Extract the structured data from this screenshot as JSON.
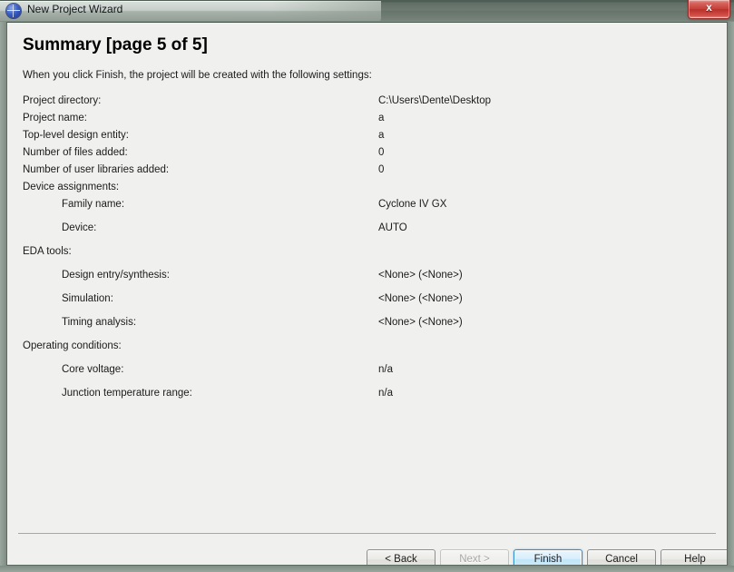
{
  "window": {
    "title": "New Project Wizard",
    "app_icon": "quartus-globe-icon",
    "close_label": "x"
  },
  "page": {
    "title": "Summary [page 5 of 5]",
    "intro": "When you click Finish, the project will be created with the following settings:"
  },
  "settings": [
    {
      "label": "Project directory:",
      "value": "C:\\Users\\Dente\\Desktop",
      "indent": false,
      "spacing": "tight"
    },
    {
      "label": "Project name:",
      "value": "a",
      "indent": false,
      "spacing": "tight"
    },
    {
      "label": "Top-level design entity:",
      "value": "a",
      "indent": false,
      "spacing": "tight"
    },
    {
      "label": "Number of files added:",
      "value": "0",
      "indent": false,
      "spacing": "tight"
    },
    {
      "label": "Number of user libraries added:",
      "value": "0",
      "indent": false,
      "spacing": "tight"
    },
    {
      "label": "Device assignments:",
      "value": "",
      "indent": false,
      "spacing": "tight"
    },
    {
      "label": "Family name:",
      "value": "Cyclone IV GX",
      "indent": true,
      "spacing": "loose"
    },
    {
      "label": "Device:",
      "value": "AUTO",
      "indent": true,
      "spacing": "loose"
    },
    {
      "label": "EDA tools:",
      "value": "",
      "indent": false,
      "spacing": "loose"
    },
    {
      "label": "Design entry/synthesis:",
      "value": "<None> (<None>)",
      "indent": true,
      "spacing": "loose"
    },
    {
      "label": "Simulation:",
      "value": "<None> (<None>)",
      "indent": true,
      "spacing": "loose"
    },
    {
      "label": "Timing analysis:",
      "value": "<None> (<None>)",
      "indent": true,
      "spacing": "loose"
    },
    {
      "label": "Operating conditions:",
      "value": "",
      "indent": false,
      "spacing": "loose"
    },
    {
      "label": "Core voltage:",
      "value": "n/a",
      "indent": true,
      "spacing": "loose"
    },
    {
      "label": "Junction temperature range:",
      "value": "n/a",
      "indent": true,
      "spacing": "loose"
    }
  ],
  "buttons": {
    "back": {
      "label": "< Back",
      "state": "enabled"
    },
    "next": {
      "label": "Next >",
      "state": "disabled"
    },
    "finish": {
      "label": "Finish",
      "state": "default"
    },
    "cancel": {
      "label": "Cancel",
      "state": "enabled"
    },
    "help": {
      "label": "Help",
      "state": "enabled"
    }
  },
  "colors": {
    "titlebar": "#6d7a72",
    "client_background": "#f0f0ee",
    "close_button": "#c43f39",
    "default_button_border": "#2f8fd4",
    "separator": "#a6a6a2"
  }
}
